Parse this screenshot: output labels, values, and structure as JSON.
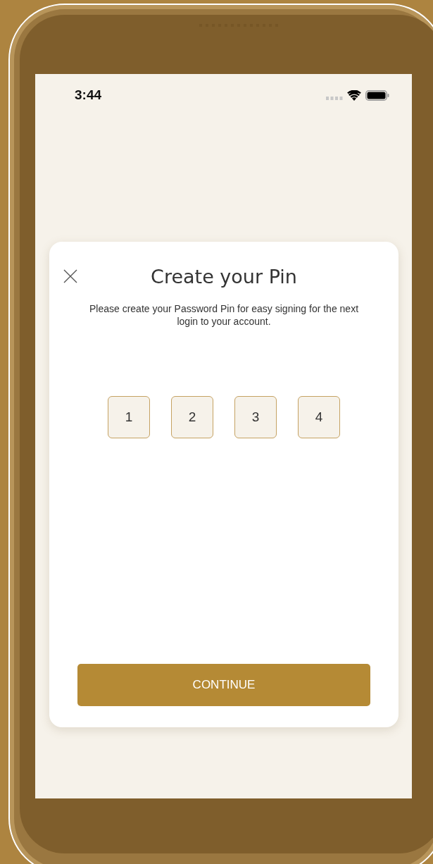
{
  "status_bar": {
    "time": "3:44"
  },
  "dialog": {
    "title": "Create your Pin",
    "description": "Please create your Password Pin for easy signing for the next login to your account.",
    "pin_digits": [
      {
        "value": "1"
      },
      {
        "value": "2"
      },
      {
        "value": "3"
      },
      {
        "value": "4"
      }
    ],
    "continue_button": {
      "label": "CONTINUE"
    }
  }
}
